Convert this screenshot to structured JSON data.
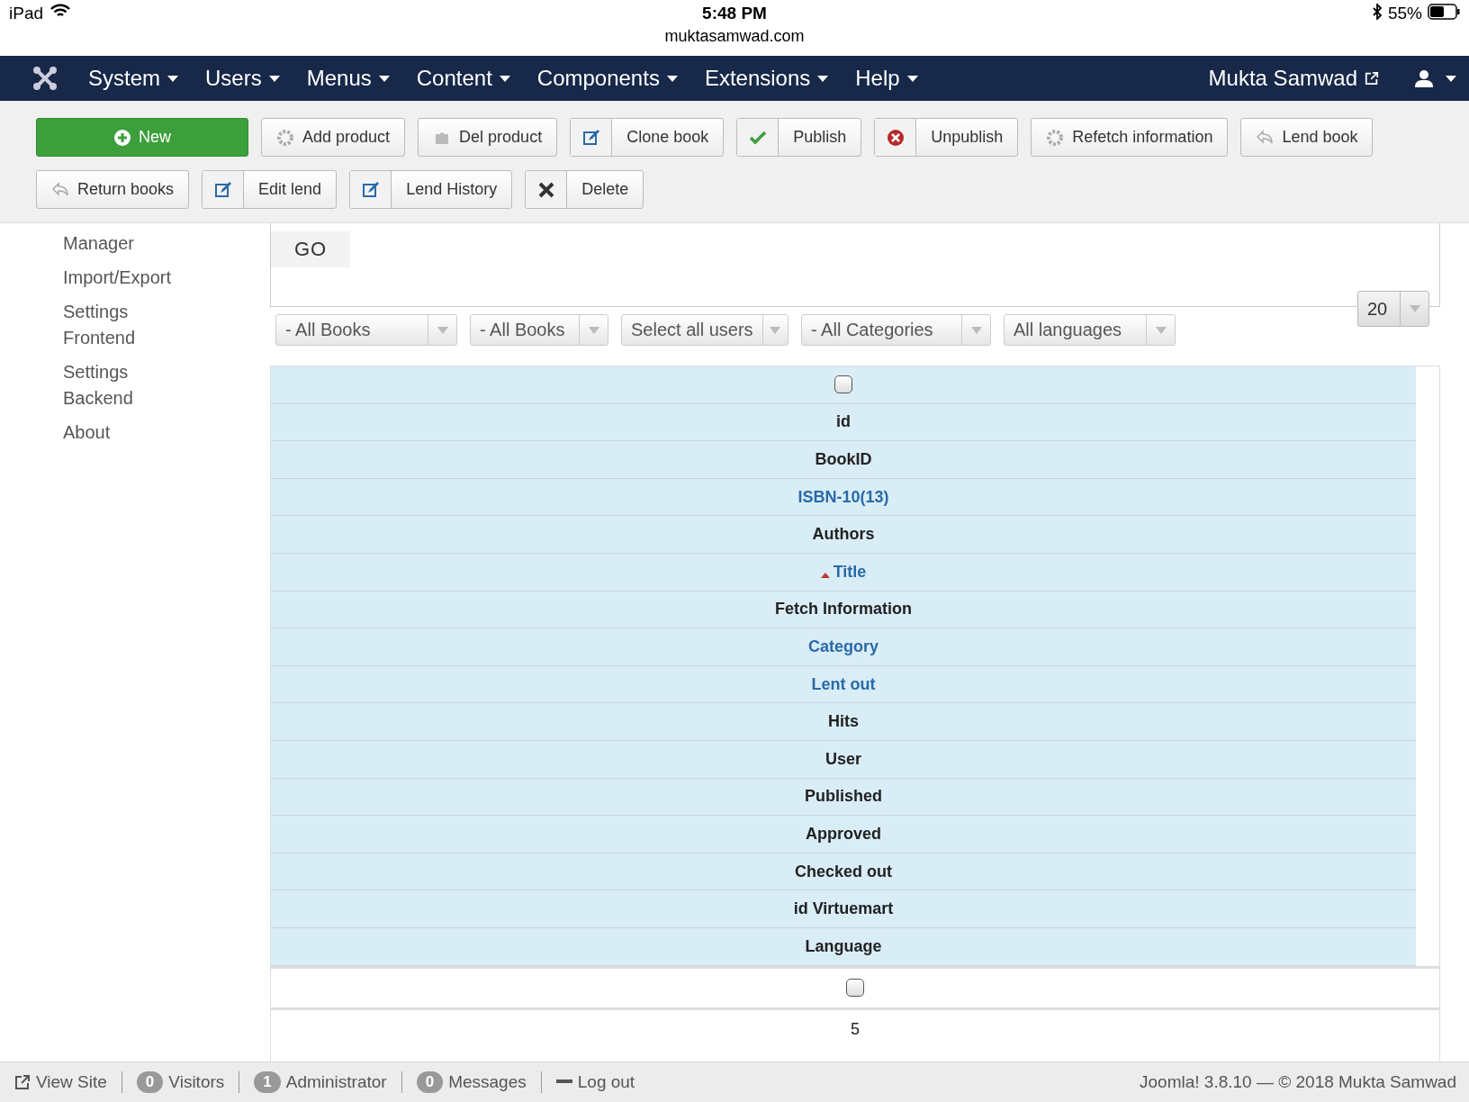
{
  "device_bar": {
    "device": "iPad",
    "time": "5:48 PM",
    "url": "muktasamwad.com",
    "battery": "55%"
  },
  "nav": {
    "menus": [
      "System",
      "Users",
      "Menus",
      "Content",
      "Components",
      "Extensions",
      "Help"
    ],
    "user_name": "Mukta Samwad"
  },
  "toolbar": {
    "buttons": [
      {
        "label": "New",
        "kind": "primary"
      },
      {
        "label": "Add product",
        "kind": "plain"
      },
      {
        "label": "Del product",
        "kind": "plain"
      },
      {
        "label": "Clone book",
        "kind": "split"
      },
      {
        "label": "Publish",
        "kind": "split"
      },
      {
        "label": "Unpublish",
        "kind": "split"
      },
      {
        "label": "Refetch information",
        "kind": "plain"
      },
      {
        "label": "Lend book",
        "kind": "plain"
      },
      {
        "label": "Return books",
        "kind": "plain"
      },
      {
        "label": "Edit lend",
        "kind": "split"
      },
      {
        "label": "Lend History",
        "kind": "split"
      },
      {
        "label": "Delete",
        "kind": "split"
      }
    ]
  },
  "sidebar": {
    "items": [
      "Manager",
      "Import/Export",
      "Settings Frontend",
      "Settings Backend",
      "About"
    ]
  },
  "search": {
    "go_button": "GO"
  },
  "filters": [
    "- All Books",
    "- All Books",
    "Select all users",
    "- All Categories",
    "All languages"
  ],
  "list_limit": "20",
  "table": {
    "columns": [
      {
        "kind": "checkbox",
        "checked": false
      },
      {
        "kind": "text",
        "label": "id",
        "link": false,
        "sorted": false
      },
      {
        "kind": "text",
        "label": "BookID",
        "link": false,
        "sorted": false
      },
      {
        "kind": "text",
        "label": "ISBN-10(13)",
        "link": true,
        "sorted": false
      },
      {
        "kind": "text",
        "label": "Authors",
        "link": false,
        "sorted": false
      },
      {
        "kind": "text",
        "label": "Title",
        "link": true,
        "sorted": true
      },
      {
        "kind": "text",
        "label": "Fetch Information",
        "link": false,
        "sorted": false
      },
      {
        "kind": "text",
        "label": "Category",
        "link": true,
        "sorted": false
      },
      {
        "kind": "text",
        "label": "Lent out",
        "link": true,
        "sorted": false
      },
      {
        "kind": "text",
        "label": "Hits",
        "link": false,
        "sorted": false
      },
      {
        "kind": "text",
        "label": "User",
        "link": false,
        "sorted": false
      },
      {
        "kind": "text",
        "label": "Published",
        "link": false,
        "sorted": false
      },
      {
        "kind": "text",
        "label": "Approved",
        "link": false,
        "sorted": false
      },
      {
        "kind": "text",
        "label": "Checked out",
        "link": false,
        "sorted": false
      },
      {
        "kind": "text",
        "label": "id Virtuemart",
        "link": false,
        "sorted": false
      },
      {
        "kind": "text",
        "label": "Language",
        "link": false,
        "sorted": false
      }
    ],
    "rows": [
      {
        "kind": "checkbox",
        "checked": false
      },
      {
        "kind": "text",
        "value": "5"
      }
    ]
  },
  "footer": {
    "items": [
      {
        "kind": "link",
        "label": "View Site"
      },
      {
        "kind": "badge",
        "badge": "0",
        "label": "Visitors"
      },
      {
        "kind": "badge",
        "badge": "1",
        "label": "Administrator"
      },
      {
        "kind": "badge",
        "badge": "0",
        "label": "Messages"
      },
      {
        "kind": "link",
        "label": "Log out"
      }
    ],
    "copyright": "Joomla! 3.8.10  —  © 2018 Mukta Samwad"
  }
}
